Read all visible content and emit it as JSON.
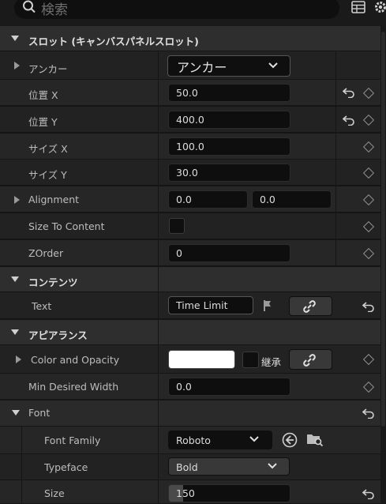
{
  "search": {
    "placeholder": "検索"
  },
  "slot": {
    "title": "スロット (キャンバスパネルスロット)",
    "anchor_label": "アンカー",
    "anchor_value": "アンカー",
    "pos_x_label": "位置 X",
    "pos_x": "50.0",
    "pos_y_label": "位置 Y",
    "pos_y": "400.0",
    "size_x_label": "サイズ X",
    "size_x": "100.0",
    "size_y_label": "サイズ Y",
    "size_y": "30.0",
    "alignment_label": "Alignment",
    "alignment_x": "0.0",
    "alignment_y": "0.0",
    "size_to_content_label": "Size To Content",
    "zorder_label": "ZOrder",
    "zorder": "0"
  },
  "content": {
    "title": "コンテンツ",
    "text_label": "Text",
    "text_value": "Time Limit"
  },
  "appearance": {
    "title": "アピアランス",
    "color_label": "Color and Opacity",
    "inherit_label": "継承",
    "min_width_label": "Min Desired Width",
    "min_width": "0.0",
    "font_label": "Font",
    "font_family_label": "Font Family",
    "font_family": "Roboto",
    "typeface_label": "Typeface",
    "typeface": "Bold",
    "size_label": "Size",
    "size": "150",
    "size_slider_fraction": 0.02
  },
  "colors": {
    "swatch": "#ffffff",
    "bg": "#151515"
  }
}
